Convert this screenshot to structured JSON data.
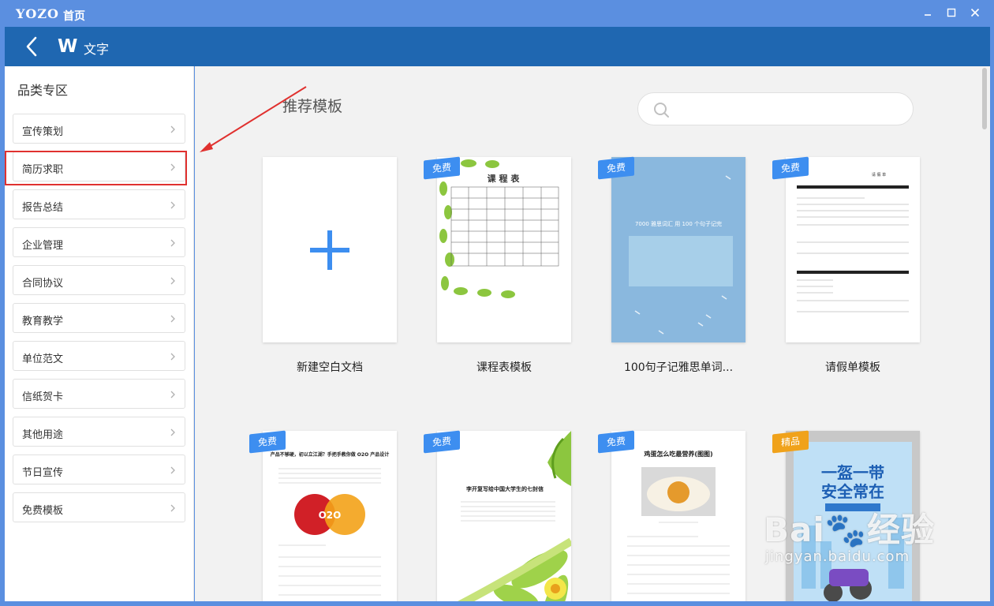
{
  "window": {
    "brand": "YOZO",
    "title": "首页"
  },
  "navbar": {
    "app_logo": "W",
    "app_name": "文字"
  },
  "sidebar": {
    "title": "品类专区",
    "selected_index": 1,
    "items": [
      {
        "label": "宣传策划"
      },
      {
        "label": "简历求职"
      },
      {
        "label": "报告总结"
      },
      {
        "label": "企业管理"
      },
      {
        "label": "合同协议"
      },
      {
        "label": "教育教学"
      },
      {
        "label": "单位范文"
      },
      {
        "label": "信纸贺卡"
      },
      {
        "label": "其他用途"
      },
      {
        "label": "节日宣传"
      },
      {
        "label": "免费模板"
      }
    ]
  },
  "main": {
    "section_title": "推荐模板",
    "search_placeholder": "",
    "templates": [
      {
        "name": "新建空白文档",
        "badge": ""
      },
      {
        "name": "课程表模板",
        "badge": "免费"
      },
      {
        "name": "100句子记雅思单词...",
        "badge": "免费"
      },
      {
        "name": "请假单模板",
        "badge": "免费"
      },
      {
        "name": "",
        "badge": "免费"
      },
      {
        "name": "",
        "badge": "免费"
      },
      {
        "name": "",
        "badge": "免费"
      },
      {
        "name": "",
        "badge": "精品"
      }
    ],
    "thumbnails": {
      "schedule_title": "课 程 表",
      "ielts_title": "7000 雅思词汇 用 100 个句子记完",
      "leave_title": "请 假 单",
      "o2o_title": "产品不够硬，初以立江湖？手把手教你做 O2O 产品设计",
      "o2o_logo": "O2O",
      "letter_title": "李开复写给中国大学生的七封信",
      "egg_title": "鸡蛋怎么吃最营养(图图)",
      "safety_line1": "一盔一带",
      "safety_line2": "安全常在"
    }
  },
  "watermark": {
    "main": "Bai🐾经验",
    "sub": "jingyan.baidu.com"
  },
  "colors": {
    "titlebar": "#5b8fe0",
    "navbar": "#1f67b1",
    "accent": "#3d8ef0",
    "premium": "#f0a21b",
    "highlight": "#e0312f"
  },
  "icons": [
    "back-arrow-icon",
    "search-icon",
    "chevron-right-icon",
    "plus-icon",
    "minimize-icon",
    "maximize-icon",
    "close-icon"
  ]
}
